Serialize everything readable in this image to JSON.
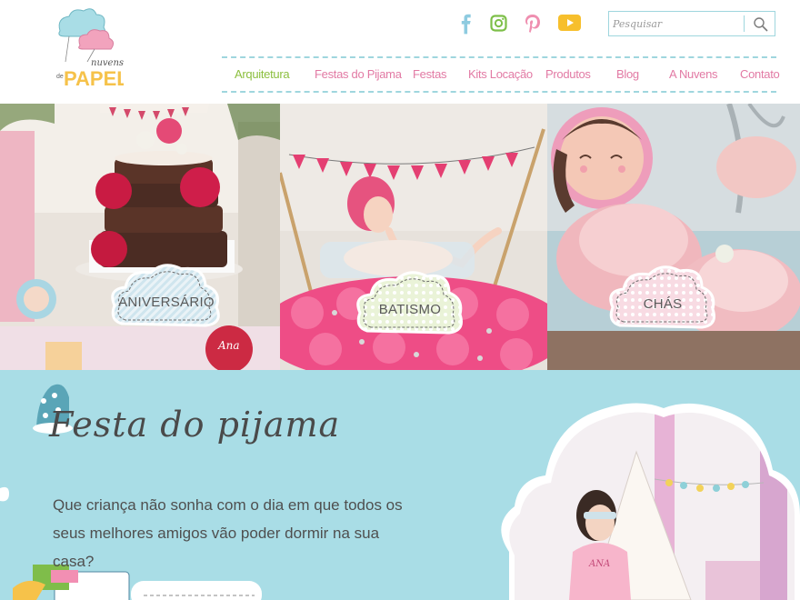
{
  "header": {
    "logo_top": "nuvens",
    "logo_de": "de",
    "logo_main": "PAPEL",
    "search": {
      "placeholder": "Pesquisar"
    }
  },
  "social": [
    "facebook-icon",
    "instagram-icon",
    "pinterest-icon",
    "youtube-icon"
  ],
  "nav": {
    "items": [
      {
        "label": "Arquitetura",
        "active": true
      },
      {
        "label": "Festas do Pijama"
      },
      {
        "label": "Festas"
      },
      {
        "label": "Kits Locação"
      },
      {
        "label": "Produtos"
      },
      {
        "label": "Blog"
      },
      {
        "label": "A Nuvens"
      },
      {
        "label": "Contato"
      }
    ]
  },
  "tiles": [
    {
      "label": "ANIVERSÁRIO",
      "ana_tag": "Ana"
    },
    {
      "label": "BATISMO"
    },
    {
      "label": "CHÁS"
    }
  ],
  "section": {
    "title": "Festa do pijama",
    "lede": "Que criança não sonha com o dia em que todos os seus melhores amigos vão poder dormir na sua casa?",
    "shirt_text": "ANA"
  },
  "colors": {
    "accent_blue": "#9fd6de",
    "nav_pink": "#e27aa4",
    "nav_active": "#8cbf3f",
    "section_bg": "#a9dde6"
  }
}
